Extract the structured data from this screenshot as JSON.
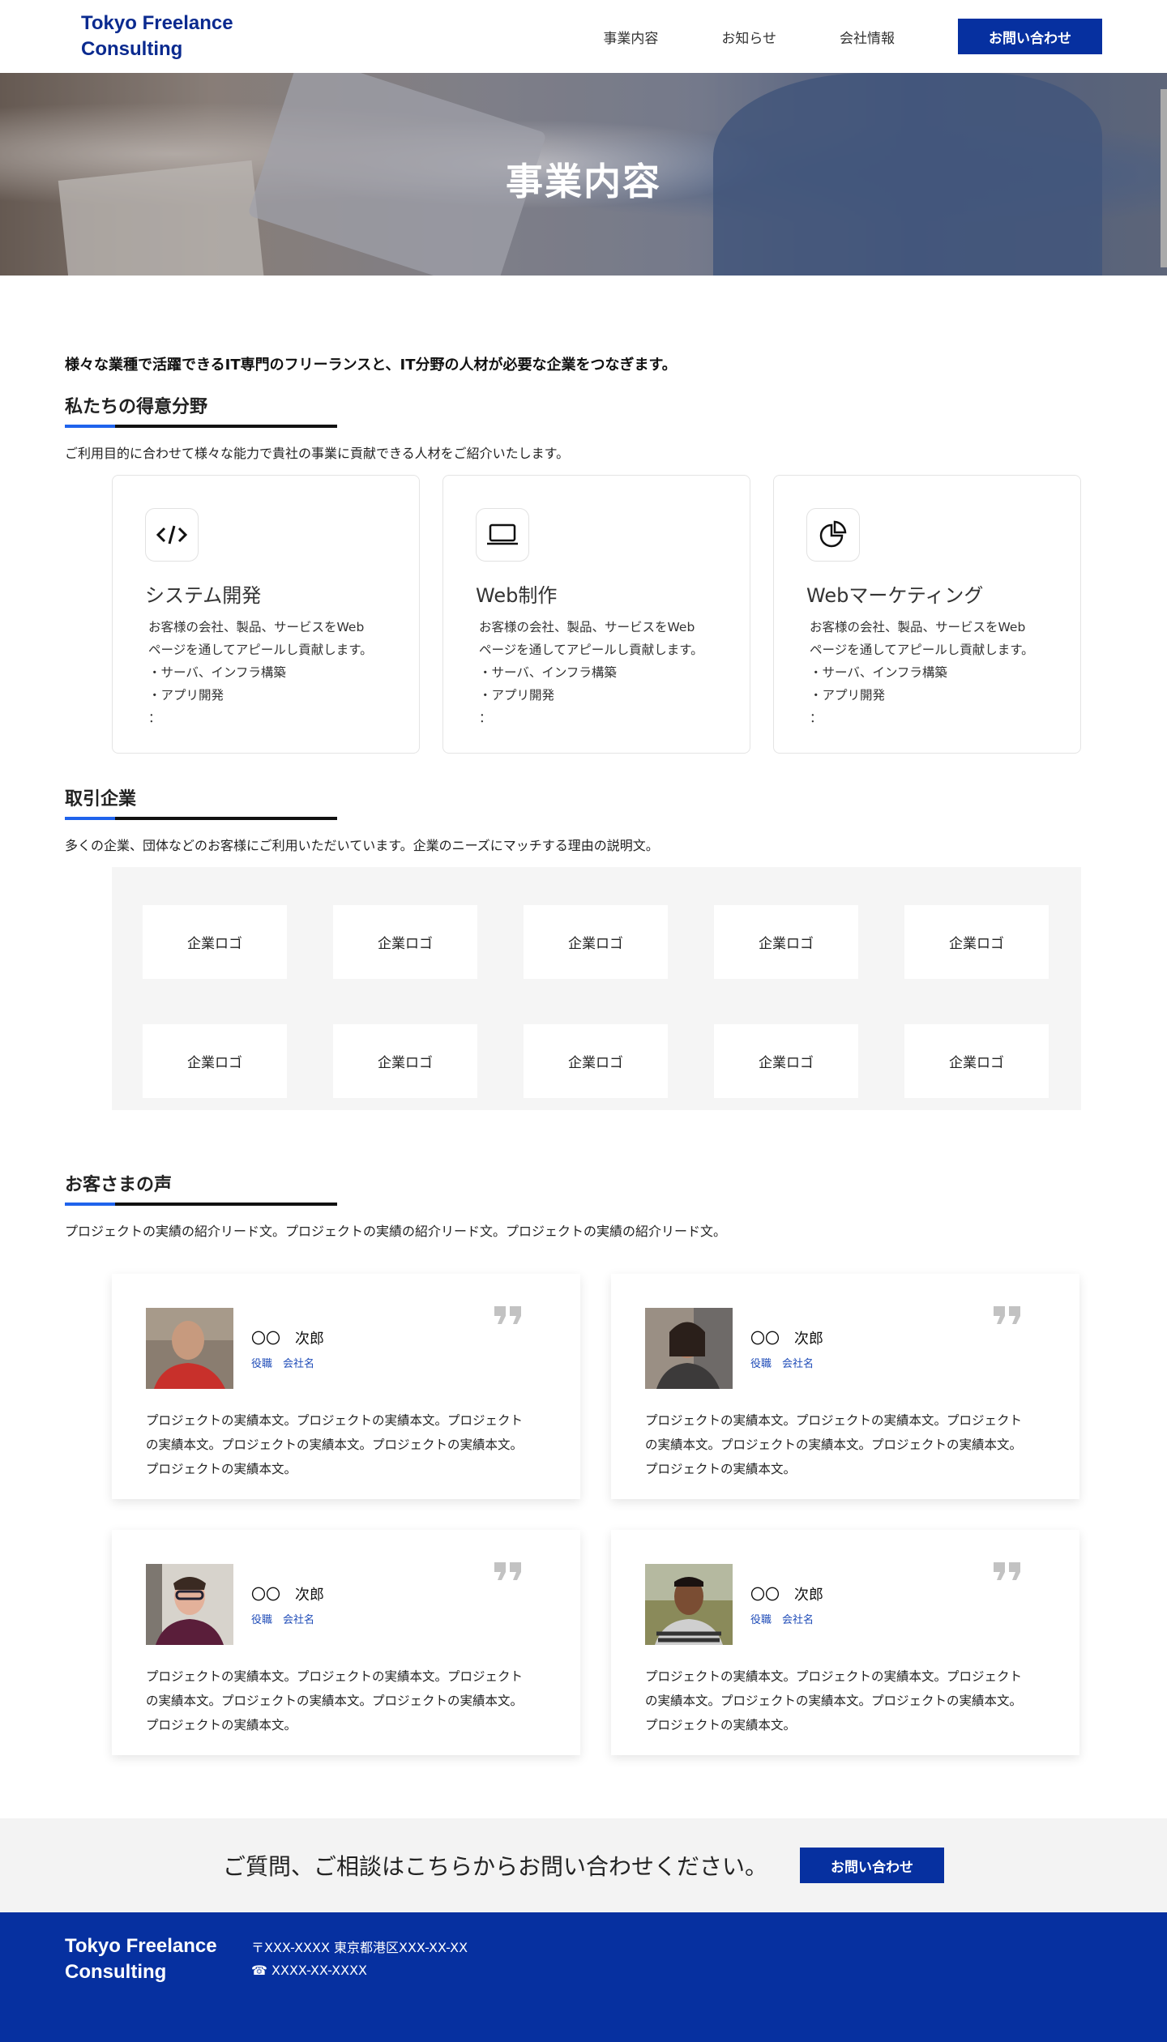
{
  "header": {
    "logo": "Tokyo Freelance Consulting",
    "nav": [
      "事業内容",
      "お知らせ",
      "会社情報"
    ],
    "contact_button": "お問い合わせ"
  },
  "hero": {
    "title": "事業内容"
  },
  "lead": "様々な業種で活躍できるIT専門のフリーランスと、IT分野の人材が必要な企業をつなぎます。",
  "expertise": {
    "title": "私たちの得意分野",
    "description": "ご利用目的に合わせて様々な能力で貴社の事業に貢献できる人材をご紹介いたします。",
    "cards": [
      {
        "icon": "code-icon",
        "title": "システム開発",
        "lines": [
          "お客様の会社、製品、サービスをWeb",
          "ページを通してアピールし貢献します。",
          "・サーバ、インフラ構築",
          "・アプリ開発",
          "："
        ]
      },
      {
        "icon": "laptop-icon",
        "title": "Web制作",
        "lines": [
          "お客様の会社、製品、サービスをWeb",
          "ページを通してアピールし貢献します。",
          "・サーバ、インフラ構築",
          "・アプリ開発",
          "："
        ]
      },
      {
        "icon": "pie-chart-icon",
        "title": "Webマーケティング",
        "lines": [
          "お客様の会社、製品、サービスをWeb",
          "ページを通してアピールし貢献します。",
          "・サーバ、インフラ構築",
          "・アプリ開発",
          "："
        ]
      }
    ]
  },
  "clients": {
    "title": "取引企業",
    "description": "多くの企業、団体などのお客様にご利用いただいています。企業のニーズにマッチする理由の説明文。",
    "logos": [
      "企業ロゴ",
      "企業ロゴ",
      "企業ロゴ",
      "企業ロゴ",
      "企業ロゴ",
      "企業ロゴ",
      "企業ロゴ",
      "企業ロゴ",
      "企業ロゴ",
      "企業ロゴ"
    ]
  },
  "voices": {
    "title": "お客さまの声",
    "description": "プロジェクトの実績の紹介リード文。プロジェクトの実績の紹介リード文。プロジェクトの実績の紹介リード文。",
    "items": [
      {
        "name": "〇〇　次郎",
        "role": "役職　会社名",
        "lines": [
          "プロジェクトの実績本文。プロジェクトの実績本文。プロジェクト",
          "の実績本文。プロジェクトの実績本文。プロジェクトの実績本文。",
          "プロジェクトの実績本文。"
        ]
      },
      {
        "name": "〇〇　次郎",
        "role": "役職　会社名",
        "lines": [
          "プロジェクトの実績本文。プロジェクトの実績本文。プロジェクト",
          "の実績本文。プロジェクトの実績本文。プロジェクトの実績本文。",
          "プロジェクトの実績本文。"
        ]
      },
      {
        "name": "〇〇　次郎",
        "role": "役職　会社名",
        "lines": [
          "プロジェクトの実績本文。プロジェクトの実績本文。プロジェクト",
          "の実績本文。プロジェクトの実績本文。プロジェクトの実績本文。",
          "プロジェクトの実績本文。"
        ]
      },
      {
        "name": "〇〇　次郎",
        "role": "役職　会社名",
        "lines": [
          "プロジェクトの実績本文。プロジェクトの実績本文。プロジェクト",
          "の実績本文。プロジェクトの実績本文。プロジェクトの実績本文。",
          "プロジェクトの実績本文。"
        ]
      }
    ]
  },
  "cta": {
    "text": "ご質問、ご相談はこちらからお問い合わせください。",
    "button": "お問い合わせ"
  },
  "footer": {
    "logo": "Tokyo Freelance Consulting",
    "address": "〒XXX-XXXX 東京都港区XXX-XX-XX",
    "phone": "☎ XXXX-XX-XXXX"
  },
  "colors": {
    "brand": "#0630a0",
    "accent_line": "#1f63ec"
  }
}
